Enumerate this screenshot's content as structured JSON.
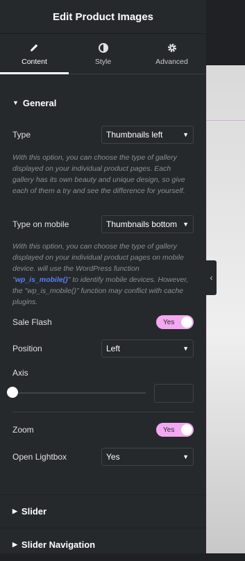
{
  "header": {
    "title": "Edit Product Images"
  },
  "tabs": [
    {
      "label": "Content",
      "icon": "pencil-icon"
    },
    {
      "label": "Style",
      "icon": "half-circle-icon"
    },
    {
      "label": "Advanced",
      "icon": "gear-icon"
    }
  ],
  "general": {
    "title": "General",
    "type": {
      "label": "Type",
      "value": "Thumbnails left"
    },
    "type_desc": "With this option, you can choose the type of gallery displayed on your individual product pages. Each gallery has its own beauty and unique design, so give each of them a try and see the difference for yourself.",
    "type_mobile": {
      "label": "Type on mobile",
      "value": "Thumbnails bottom"
    },
    "mobile_desc_a": "With this option, you can choose the type of gallery displayed on your individual product pages on mobile device. will use the WordPress function \"",
    "mobile_desc_fn": "wp_is_mobile()",
    "mobile_desc_b": "\" to identify mobile devices. However, the \"wp_is_mobile()\" function may conflict with cache plugins.",
    "sale_flash": {
      "label": "Sale Flash",
      "toggle": "Yes"
    },
    "position": {
      "label": "Position",
      "value": "Left"
    },
    "axis": {
      "label": "Axis",
      "value": ""
    },
    "zoom": {
      "label": "Zoom",
      "toggle": "Yes"
    },
    "lightbox": {
      "label": "Open Lightbox",
      "value": "Yes"
    }
  },
  "sections": {
    "slider": "Slider",
    "slider_nav": "Slider Navigation"
  },
  "colors": {
    "accent": "#f3a8f1",
    "panel": "#26292c",
    "link": "#5b7cf6"
  }
}
